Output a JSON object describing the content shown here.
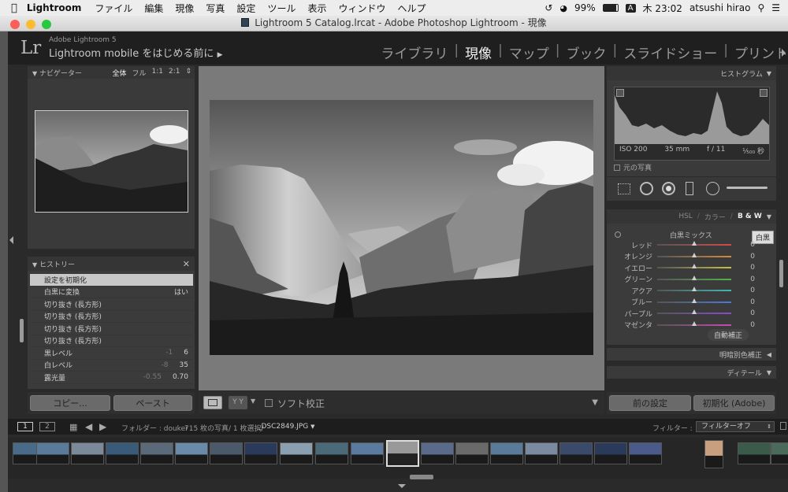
{
  "menubar": {
    "app": "Lightroom",
    "items": [
      "ファイル",
      "編集",
      "現像",
      "写真",
      "設定",
      "ツール",
      "表示",
      "ウィンドウ",
      "ヘルプ"
    ],
    "battery": "99%",
    "input_badge": "A",
    "clock": "木 23:02",
    "user": "atsushi hirao"
  },
  "window": {
    "title": "Lightroom 5 Catalog.lrcat - Adobe Photoshop Lightroom - 現像"
  },
  "header": {
    "logo": "Lr",
    "brand_small": "Adobe Lightroom 5",
    "brand_big": "Lightroom mobile をはじめる前に",
    "modules": [
      "ライブラリ",
      "現像",
      "マップ",
      "ブック",
      "スライドショー",
      "プリント"
    ],
    "active_module": "現像"
  },
  "navigator": {
    "title": "ナビゲーター",
    "zoom_options": [
      "全体",
      "フル",
      "1:1",
      "2:1"
    ]
  },
  "history": {
    "title": "ヒストリー",
    "items": [
      {
        "label": "設定を初期化",
        "before": "",
        "after": ""
      },
      {
        "label": "白黒に変換",
        "before": "",
        "after": "はい"
      },
      {
        "label": "切り抜き (長方形)",
        "before": "",
        "after": ""
      },
      {
        "label": "切り抜き (長方形)",
        "before": "",
        "after": ""
      },
      {
        "label": "切り抜き (長方形)",
        "before": "",
        "after": ""
      },
      {
        "label": "切り抜き (長方形)",
        "before": "",
        "after": ""
      },
      {
        "label": "黒レベル",
        "before": "-1",
        "after": "6"
      },
      {
        "label": "白レベル",
        "before": "-8",
        "after": "35"
      },
      {
        "label": "露光量",
        "before": "-0.55",
        "after": "0.70"
      }
    ]
  },
  "left_buttons": {
    "copy": "コピー...",
    "paste": "ペースト"
  },
  "toolbar": {
    "soft_proof": "ソフト校正",
    "yy": "Y Y"
  },
  "histogram": {
    "title": "ヒストグラム",
    "iso": "ISO 200",
    "focal": "35 mm",
    "aperture": "f / 11",
    "shutter": "¹⁄₅₀₀ 秒",
    "original": "元の写真"
  },
  "bw_panel": {
    "tabs": [
      "HSL",
      "/",
      "カラー",
      "/",
      "B & W"
    ],
    "mix_title": "白黒ミックス",
    "badge": "白黒",
    "sliders": [
      {
        "label": "レッド",
        "value": "0",
        "color": "#d34a4a"
      },
      {
        "label": "オレンジ",
        "value": "0",
        "color": "#d88a3a"
      },
      {
        "label": "イエロー",
        "value": "0",
        "color": "#c9c040"
      },
      {
        "label": "グリーン",
        "value": "0",
        "color": "#52b04a"
      },
      {
        "label": "アクア",
        "value": "0",
        "color": "#40b8b0"
      },
      {
        "label": "ブルー",
        "value": "0",
        "color": "#4a7ad8"
      },
      {
        "label": "パープル",
        "value": "0",
        "color": "#8a4ad0"
      },
      {
        "label": "マゼンタ",
        "value": "0",
        "color": "#c84ab0"
      }
    ],
    "auto": "自動補正"
  },
  "split_tone": {
    "title": "明暗別色補正"
  },
  "detail": {
    "title": "ディテール"
  },
  "right_buttons": {
    "previous": "前の設定",
    "reset": "初期化 (Adobe)"
  },
  "filmstrip_bar": {
    "monitor1": "1",
    "monitor2": "2",
    "folder_label": "フォルダー : doukei",
    "count": "715 枚の写真/ 1 枚選択/",
    "file": "_DSC2849.JPG",
    "filter_label": "フィルター :",
    "filter_value": "フィルターオフ"
  }
}
